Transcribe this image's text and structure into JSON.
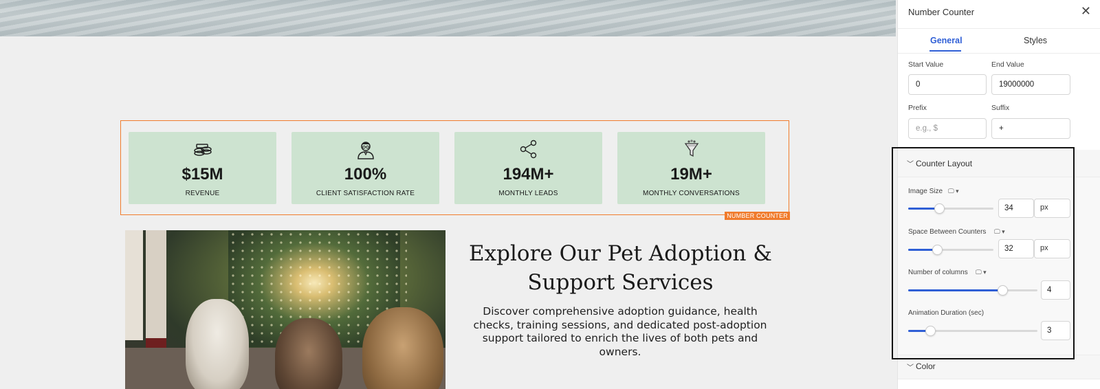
{
  "canvas": {
    "counters": [
      {
        "icon": "money-stack-icon",
        "value": "$15M",
        "label": "REVENUE"
      },
      {
        "icon": "user-glasses-icon",
        "value": "100%",
        "label": "CLIENT SATISFACTION RATE"
      },
      {
        "icon": "share-icon",
        "value": "194M+",
        "label": "MONTHLY LEADS"
      },
      {
        "icon": "funnel-icon",
        "value": "19M+",
        "label": "MONTHLY CONVERSATIONS"
      }
    ],
    "counter_card_color": "#cde3d0",
    "selection_color": "#f07b2c",
    "element_tag": "NUMBER COUNTER",
    "section": {
      "title": "Explore Our Pet Adoption & Support Services",
      "text": "Discover comprehensive adoption guidance, health checks, training sessions, and dedicated post-adoption support tailored to enrich the lives of both pets and owners."
    }
  },
  "panel": {
    "title": "Number Counter",
    "close_icon": "close-icon",
    "tabs": {
      "general": "General",
      "styles": "Styles"
    },
    "active_tab": "General",
    "accent": "#2f5fd6",
    "fields": {
      "start_value_label": "Start Value",
      "start_value": "0",
      "end_value_label": "End Value",
      "end_value": "19000000",
      "prefix_label": "Prefix",
      "prefix_placeholder": "e.g., $",
      "prefix_value": "",
      "suffix_label": "Suffix",
      "suffix_value": "+"
    },
    "counter_layout": {
      "title": "Counter Layout",
      "image_size": {
        "label": "Image Size",
        "value": "34",
        "unit": "px",
        "level": 0.36
      },
      "space_between": {
        "label": "Space Between Counters",
        "value": "32",
        "unit": "px",
        "level": 0.34
      },
      "columns": {
        "label": "Number of columns",
        "value": "4",
        "level": 0.73
      },
      "animation": {
        "label": "Animation Duration (sec)",
        "value": "3",
        "level": 0.17
      }
    },
    "color_section": {
      "title": "Color"
    }
  }
}
